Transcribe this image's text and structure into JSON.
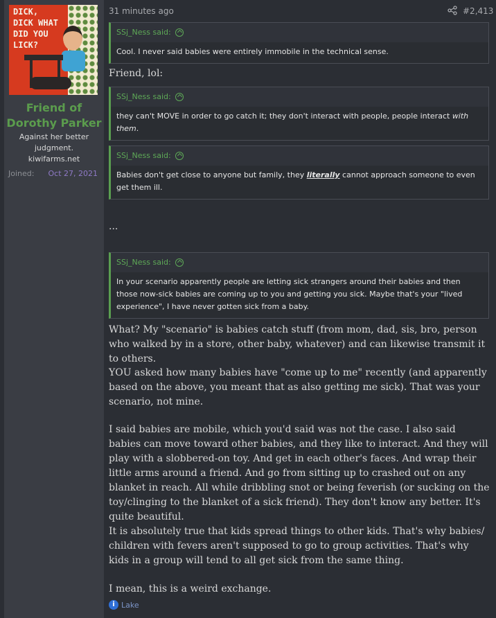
{
  "user": {
    "cover_text": "DICK, DICK WHAT DID YOU LICK?",
    "title_line1": "Friend of",
    "title_line2": "Dorothy Parker",
    "blurb_line1": "Against her better",
    "blurb_line2": "judgment.",
    "blurb_line3": "kiwifarms.net",
    "joined_label": "Joined:",
    "joined_date": "Oct 27, 2021"
  },
  "post": {
    "time": "31 minutes ago",
    "number": "#2,413",
    "quotes": [
      {
        "author": "SSj_Ness said:",
        "text": "Cool. I never said babies were entirely immobile in the technical sense."
      },
      {
        "author": "SSj_Ness said:",
        "text1": "they can't MOVE in order to go catch it; they don't interact with people, people interact ",
        "em": "with them",
        "text2": "."
      },
      {
        "author": "SSj_Ness said:",
        "text1": "Babies don't get close to anyone but family, they ",
        "strong": "literally",
        "text2": " cannot approach someone to even get them ill."
      },
      {
        "author": "SSj_Ness said:",
        "text": "In your scenario apparently people are letting sick strangers around their babies and then those now-sick babies are coming up to you and getting you sick. Maybe that's your \"lived experience\", I have never gotten sick from a baby."
      }
    ],
    "friend_line": "Friend, lol:",
    "ellipsis": "...",
    "paragraphs": [
      "What? My \"scenario\" is babies catch stuff (from mom, dad, sis, bro, person who walked by in a store, other baby, whatever) and can likewise transmit it to others.",
      "YOU asked how many babies have \"come up to me\" recently (and apparently based on the above, you meant that as also getting me sick). That was your scenario, not mine.",
      "I said babies are mobile, which you'd said was not the case. I also said babies can move toward other babies, and they like to interact. And they will play with a slobbered-on toy. And get in each other's faces. And wrap their little arms around a friend. And go from sitting up to crashed out on any blanket in reach. All while dribbling snot or being feverish (or sucking on the toy/clinging to the blanket of a sick friend). They don't know any better. It's quite beautiful.",
      "It is absolutely true that kids spread things to other kids. That's why babies/ children with fevers aren't supposed to go to group activities. That's why kids in a group will tend to all get sick from the same thing.",
      "I mean, this is a weird exchange."
    ],
    "signature": "Lake"
  }
}
